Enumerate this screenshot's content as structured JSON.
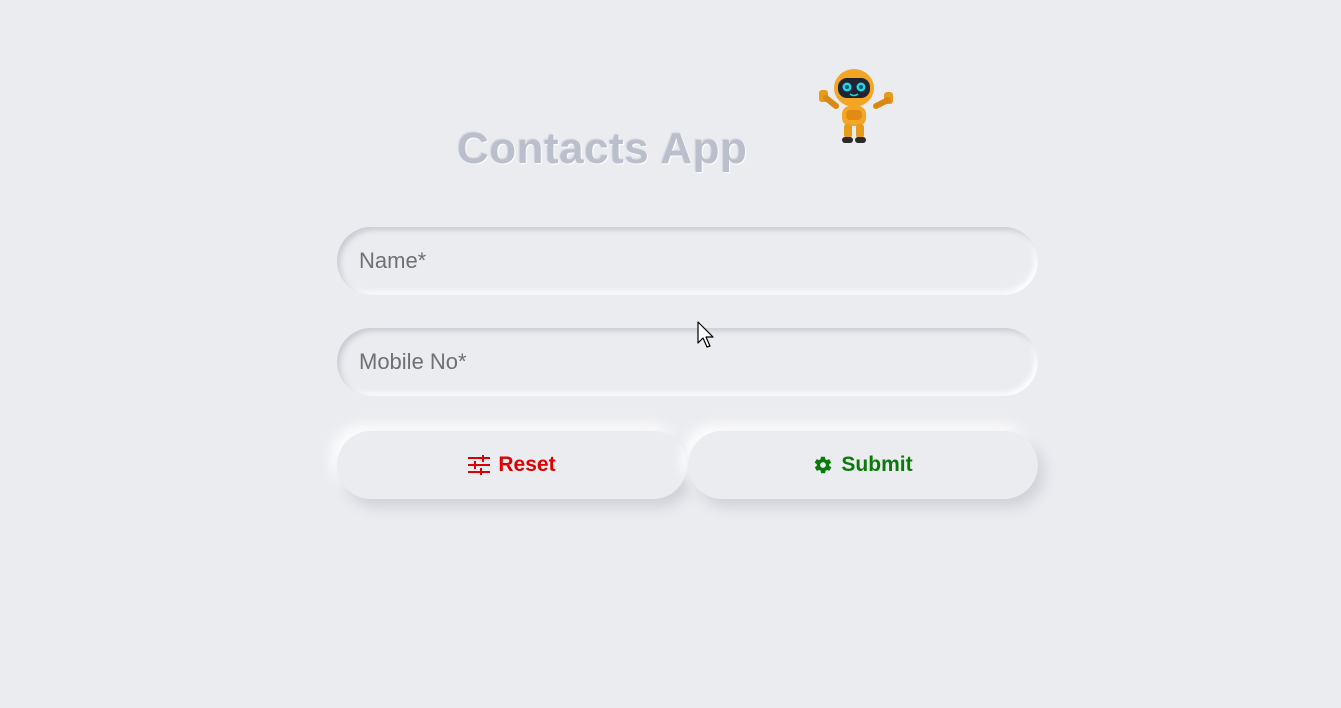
{
  "app": {
    "title": "Contacts App"
  },
  "form": {
    "name_placeholder": "Name*",
    "mobile_placeholder": "Mobile No*",
    "reset_label": "Reset",
    "submit_label": "Submit"
  },
  "colors": {
    "background": "#ebecf0",
    "title": "#bbbfcc",
    "reset": "#e00000",
    "submit": "#0a7a0a"
  },
  "icons": {
    "reset": "sliders-icon",
    "submit": "gear-icon",
    "mascot": "robot-icon"
  }
}
